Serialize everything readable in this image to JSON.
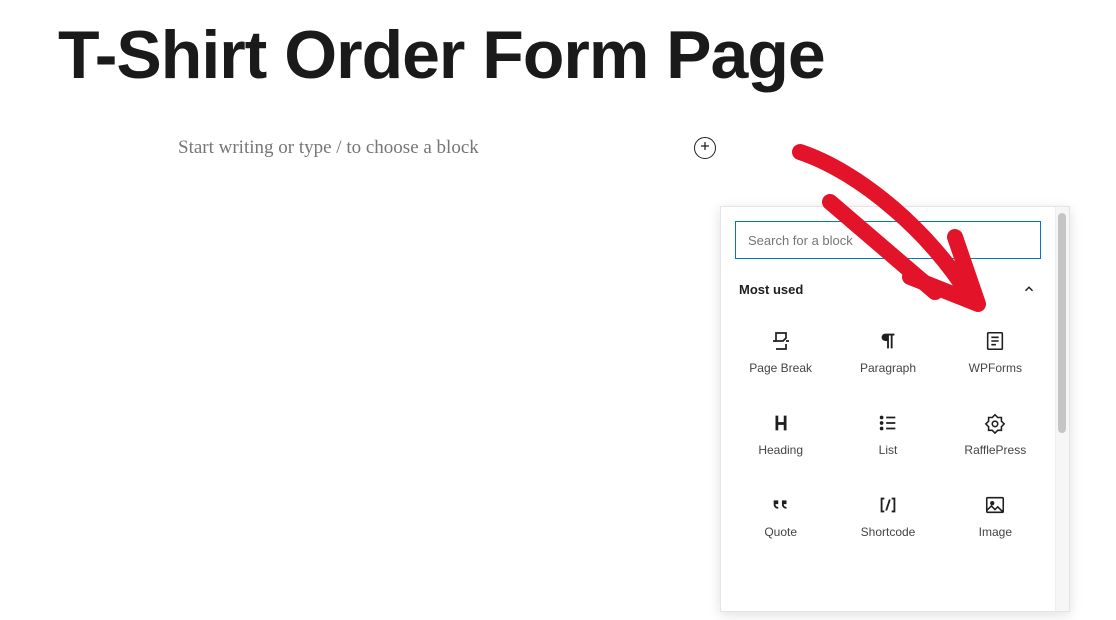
{
  "page": {
    "title": "T-Shirt Order Form Page",
    "placeholder": "Start writing or type / to choose a block"
  },
  "inserter": {
    "search_placeholder": "Search for a block",
    "section_title": "Most used",
    "blocks": [
      {
        "name": "page-break",
        "label": "Page Break",
        "icon": "page-break-icon"
      },
      {
        "name": "paragraph",
        "label": "Paragraph",
        "icon": "paragraph-icon"
      },
      {
        "name": "wpforms",
        "label": "WPForms",
        "icon": "wpforms-icon"
      },
      {
        "name": "heading",
        "label": "Heading",
        "icon": "heading-icon"
      },
      {
        "name": "list",
        "label": "List",
        "icon": "list-icon"
      },
      {
        "name": "rafflepress",
        "label": "RafflePress",
        "icon": "rafflepress-icon"
      },
      {
        "name": "quote",
        "label": "Quote",
        "icon": "quote-icon"
      },
      {
        "name": "shortcode",
        "label": "Shortcode",
        "icon": "shortcode-icon"
      },
      {
        "name": "image",
        "label": "Image",
        "icon": "image-icon"
      }
    ]
  }
}
